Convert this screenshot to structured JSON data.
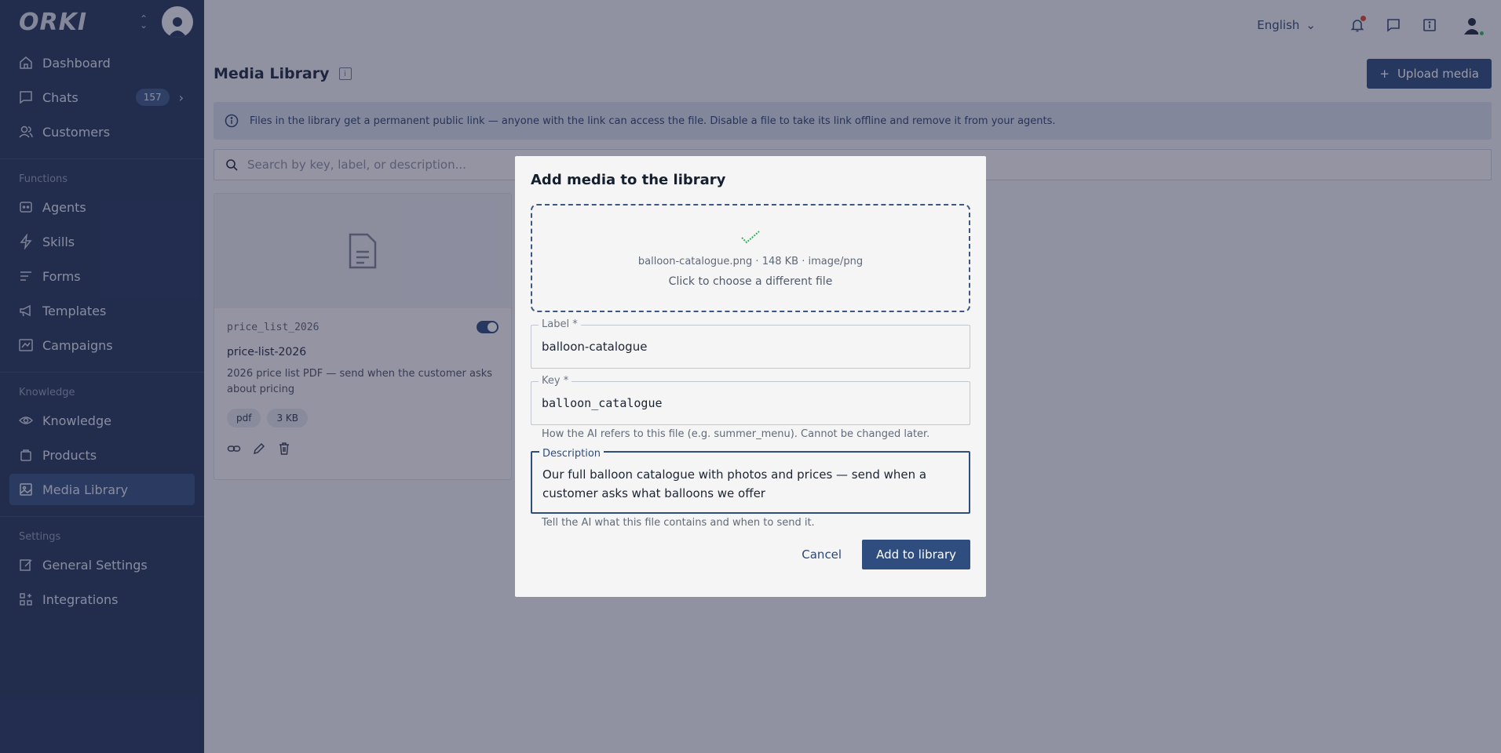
{
  "app": {
    "logo": "ORKI"
  },
  "sidebar": {
    "items": [
      {
        "label": "Dashboard",
        "icon": "home-icon"
      },
      {
        "label": "Chats",
        "icon": "chat-icon",
        "badge": "157"
      },
      {
        "label": "Customers",
        "icon": "users-icon"
      }
    ],
    "sections": [
      {
        "label": "Functions",
        "items": [
          {
            "label": "Agents",
            "icon": "agent-icon"
          },
          {
            "label": "Skills",
            "icon": "bolt-icon"
          },
          {
            "label": "Forms",
            "icon": "form-icon"
          },
          {
            "label": "Templates",
            "icon": "megaphone-icon"
          },
          {
            "label": "Campaigns",
            "icon": "campaign-icon"
          }
        ]
      },
      {
        "label": "Knowledge",
        "items": [
          {
            "label": "Knowledge",
            "icon": "eye-icon"
          },
          {
            "label": "Products",
            "icon": "bag-icon"
          },
          {
            "label": "Media Library",
            "icon": "image-icon",
            "active": true
          }
        ]
      },
      {
        "label": "Settings",
        "items": [
          {
            "label": "General Settings",
            "icon": "edit-icon"
          },
          {
            "label": "Integrations",
            "icon": "grid-icon"
          }
        ]
      }
    ]
  },
  "topbar": {
    "language": "English"
  },
  "page": {
    "title": "Media Library",
    "upload_label": "Upload media",
    "notice": "Files in the library get a permanent public link — anyone with the link can access the file. Disable a file to take its link offline and remove it from your agents.",
    "search_placeholder": "Search by key, label, or description..."
  },
  "card": {
    "key": "price_list_2026",
    "label": "price-list-2026",
    "description": "2026 price list PDF — send when the customer asks about pricing",
    "tags": [
      "pdf",
      "3 KB"
    ],
    "enabled": true
  },
  "modal": {
    "title": "Add media to the library",
    "file_info": "balloon-catalogue.png · 148 KB · image/png",
    "file_hint": "Click to choose a different file",
    "label_field": {
      "label": "Label *",
      "value": "balloon-catalogue"
    },
    "key_field": {
      "label": "Key *",
      "value": "balloon_catalogue",
      "helper": "How the AI refers to this file (e.g. summer_menu). Cannot be changed later."
    },
    "description_field": {
      "label": "Description",
      "value": "Our full balloon catalogue with photos and prices — send when a customer asks what balloons we offer",
      "helper": "Tell the AI what this file contains and when to send it."
    },
    "cancel_label": "Cancel",
    "confirm_label": "Add to library"
  },
  "colors": {
    "sidebar": "#253a5e",
    "accent": "#2f4d7e",
    "success": "#2fb55a",
    "alert": "#e0452f"
  }
}
